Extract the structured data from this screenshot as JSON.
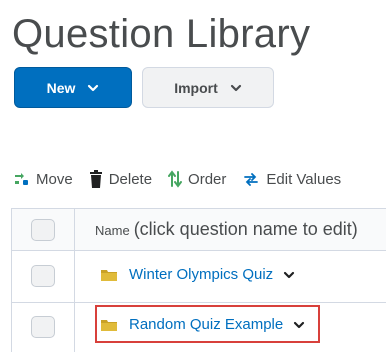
{
  "page": {
    "title": "Question Library"
  },
  "buttons": {
    "new_label": "New",
    "import_label": "Import"
  },
  "toolbar": {
    "move_label": "Move",
    "delete_label": "Delete",
    "order_label": "Order",
    "edit_values_label": "Edit Values"
  },
  "table": {
    "name_header": "Name",
    "name_header_hint": "(click question name to edit)",
    "rows": [
      {
        "label": "Winter Olympics Quiz",
        "icon": "folder-icon"
      },
      {
        "label": "Random Quiz Example",
        "icon": "folder-icon",
        "highlighted": true
      }
    ]
  },
  "colors": {
    "primary": "#006fbf",
    "folder": "#c9a227",
    "move_icon_green": "#46a661",
    "order_icon_green": "#46a661",
    "edit_icon_blue": "#006fbf",
    "highlight": "#d8403b"
  }
}
